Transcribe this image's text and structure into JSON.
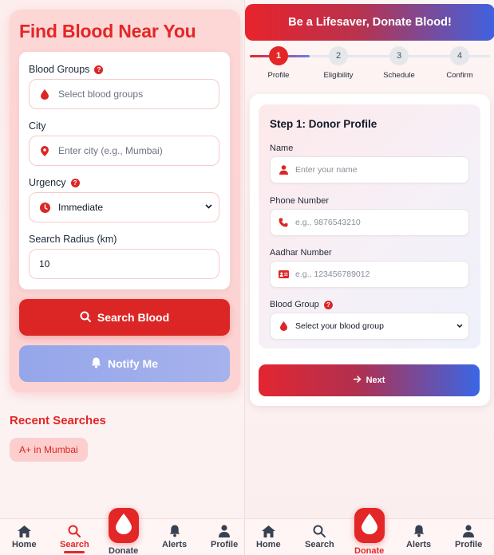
{
  "search": {
    "title": "Find Blood Near You",
    "blood_groups_label": "Blood Groups",
    "blood_groups_placeholder": "Select blood groups",
    "city_label": "City",
    "city_placeholder": "Enter city (e.g., Mumbai)",
    "urgency_label": "Urgency",
    "urgency_value": "Immediate",
    "radius_label": "Search Radius (km)",
    "radius_value": "10",
    "search_button": "Search Blood",
    "notify_button": "Notify Me",
    "recent_title": "Recent Searches",
    "recent": [
      "A+ in Mumbai"
    ]
  },
  "donate": {
    "banner": "Be a Lifesaver, Donate Blood!",
    "steps": [
      {
        "num": "1",
        "label": "Profile"
      },
      {
        "num": "2",
        "label": "Eligibility"
      },
      {
        "num": "3",
        "label": "Schedule"
      },
      {
        "num": "4",
        "label": "Confirm"
      }
    ],
    "current_step": 1,
    "step_title": "Step 1: Donor Profile",
    "name_label": "Name",
    "name_placeholder": "Enter your name",
    "phone_label": "Phone Number",
    "phone_placeholder": "e.g., 9876543210",
    "aadhar_label": "Aadhar Number",
    "aadhar_placeholder": "e.g., 123456789012",
    "blood_group_label": "Blood Group",
    "blood_group_value": "Select your blood group",
    "next_button": "Next"
  },
  "nav_left": {
    "home": "Home",
    "search": "Search",
    "donate": "Donate",
    "alerts": "Alerts",
    "profile": "Profile",
    "active": "search"
  },
  "nav_right": {
    "home": "Home",
    "search": "Search",
    "donate": "Donate",
    "alerts": "Alerts",
    "profile": "Profile",
    "active": "donate"
  },
  "colors": {
    "primary": "#e32626",
    "accent_blue": "#3f62e0",
    "notify": "#9aa9ea"
  }
}
